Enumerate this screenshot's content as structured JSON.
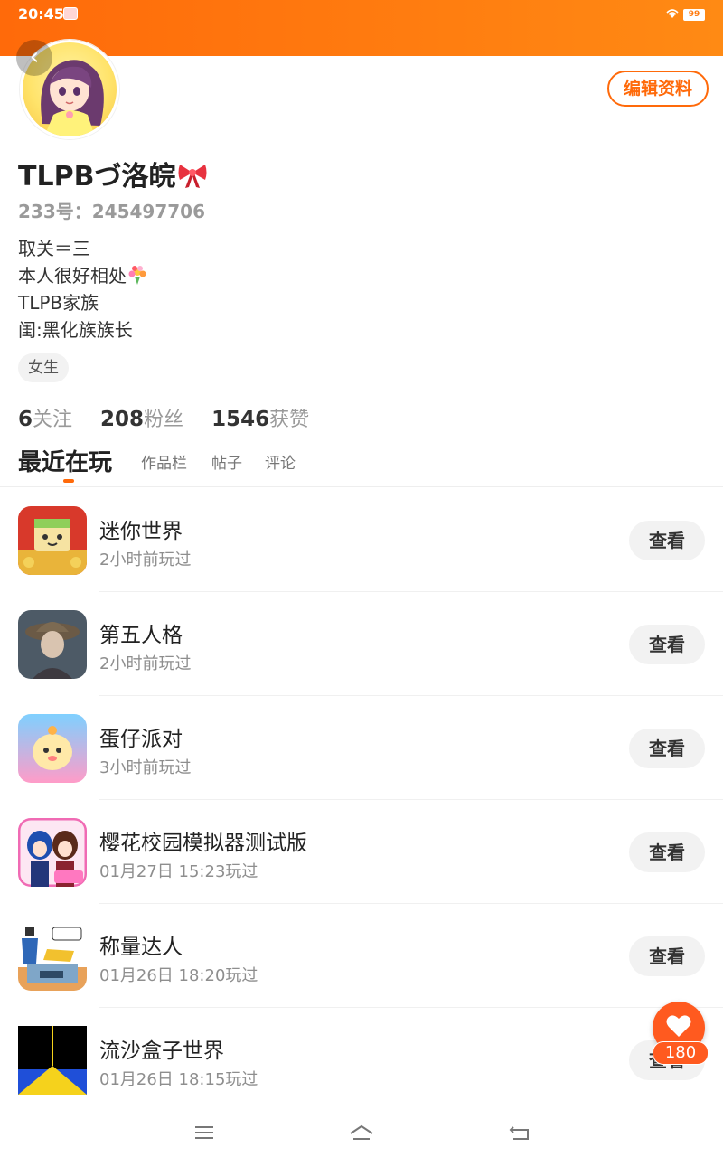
{
  "status_bar": {
    "time": "20:45",
    "battery": "99"
  },
  "header": {
    "edit_profile_label": "编辑资料"
  },
  "profile": {
    "nickname": "TLPBづ洛皖",
    "id_label": "233号：",
    "id_value": "245497706",
    "bio_lines": [
      "取关＝三",
      "本人很好相处",
      "TLPB家族",
      "闺:黑化族族长"
    ],
    "gender_tag": "女生"
  },
  "stats": {
    "following_count": "6",
    "following_label": "关注",
    "fans_count": "208",
    "fans_label": "粉丝",
    "likes_count": "1546",
    "likes_label": "获赞"
  },
  "tabs": [
    {
      "label": "最近在玩",
      "active": true
    },
    {
      "label": "作品栏",
      "active": false
    },
    {
      "label": "帖子",
      "active": false
    },
    {
      "label": "评论",
      "active": false
    }
  ],
  "games": [
    {
      "name": "迷你世界",
      "played": "2小时前玩过",
      "action": "查看"
    },
    {
      "name": "第五人格",
      "played": "2小时前玩过",
      "action": "查看"
    },
    {
      "name": "蛋仔派对",
      "played": "3小时前玩过",
      "action": "查看"
    },
    {
      "name": "樱花校园模拟器测试版",
      "played": "01月27日  15:23玩过",
      "action": "查看"
    },
    {
      "name": "称量达人",
      "played": "01月26日  18:20玩过",
      "action": "查看"
    },
    {
      "name": "流沙盒子世界",
      "played": "01月26日  18:15玩过",
      "action": "查看"
    }
  ],
  "like_fab": {
    "count": "180"
  },
  "colors": {
    "accent": "#ff6a0a",
    "fab": "#ff5a1f"
  }
}
